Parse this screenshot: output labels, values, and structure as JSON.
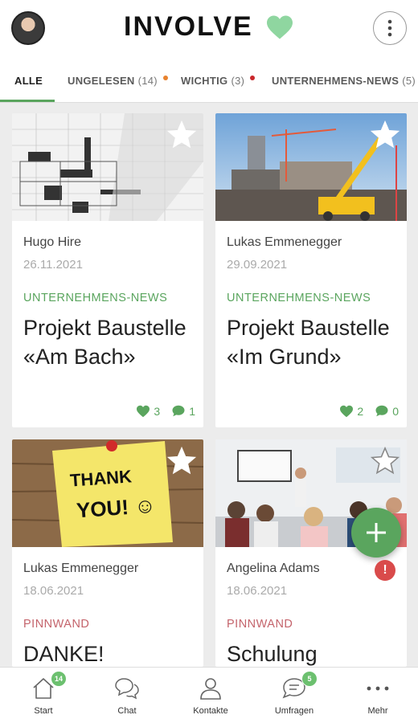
{
  "header": {
    "logo_text": "INVOLVE",
    "avatar_icon": "user-avatar",
    "more_icon": "vertical-dots-icon",
    "brand_color": "#5aa55e"
  },
  "tabs": [
    {
      "label": "ALLE",
      "count": "",
      "dot_color": "",
      "active": true
    },
    {
      "label": "UNGELESEN",
      "count": "(14)",
      "dot_color": "#e8822e",
      "active": false
    },
    {
      "label": "WICHTIG",
      "count": "(3)",
      "dot_color": "#c9262a",
      "active": false
    },
    {
      "label": "UNTERNEHMENS-NEWS",
      "count": "(5)",
      "dot_color": "",
      "active": false
    }
  ],
  "cards": [
    {
      "author": "Hugo Hire",
      "date": "26.11.2021",
      "category": "UNTERNEHMENS-NEWS",
      "category_color": "#5aa55e",
      "title": "Projekt Baustelle «Am Bach»",
      "likes": "3",
      "comments": "1",
      "image": "blueprint-drawing"
    },
    {
      "author": "Lukas Emmenegger",
      "date": "29.09.2021",
      "category": "UNTERNEHMENS-NEWS",
      "category_color": "#5aa55e",
      "title": "Projekt Baustelle «Im Grund»",
      "likes": "2",
      "comments": "0",
      "image": "construction-site-crane"
    },
    {
      "author": "Lukas Emmenegger",
      "date": "18.06.2021",
      "category": "PINNWAND",
      "category_color": "#c4636b",
      "title": "DANKE!",
      "image": "thank-you-sticky-note",
      "note_line1": "THANK",
      "note_line2": "YOU! ☺"
    },
    {
      "author": "Angelina Adams",
      "date": "18.06.2021",
      "category": "PINNWAND",
      "category_color": "#c4636b",
      "title": "Schulung",
      "image": "training-seminar-room"
    }
  ],
  "alert_badge": "!",
  "bottom_nav": [
    {
      "label": "Start",
      "icon": "home-icon",
      "badge": "14"
    },
    {
      "label": "Chat",
      "icon": "chat-bubbles-icon",
      "badge": ""
    },
    {
      "label": "Kontakte",
      "icon": "person-icon",
      "badge": ""
    },
    {
      "label": "Umfragen",
      "icon": "survey-bubble-icon",
      "badge": "5"
    },
    {
      "label": "Mehr",
      "icon": "more-dots-icon",
      "badge": ""
    }
  ]
}
